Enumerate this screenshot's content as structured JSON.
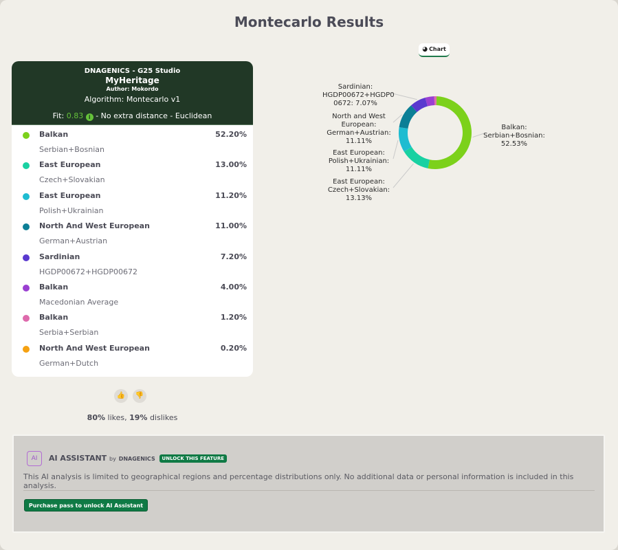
{
  "page": {
    "title": "Montecarlo Results"
  },
  "card": {
    "studio": "DNAGENICS - G25 Studio",
    "name": "MyHeritage",
    "author": "Author: Mokordo",
    "algorithm": "Algorithm: Montecarlo v1",
    "fit_label": "Fit:",
    "fit_value": "0.83",
    "fit_suffix": "- No extra distance - Euclidean",
    "info_icon": "i"
  },
  "populations": [
    {
      "region": "Balkan",
      "sample": "Serbian+Bosnian",
      "pct": "52.20%",
      "color": "#7cd11b"
    },
    {
      "region": "East European",
      "sample": "Czech+Slovakian",
      "pct": "13.00%",
      "color": "#19d1a2"
    },
    {
      "region": "East European",
      "sample": "Polish+Ukrainian",
      "pct": "11.20%",
      "color": "#1ebcd1"
    },
    {
      "region": "North And West European",
      "sample": "German+Austrian",
      "pct": "11.00%",
      "color": "#0c7f96"
    },
    {
      "region": "Sardinian",
      "sample": "HGDP00672+HGDP00672",
      "pct": "7.20%",
      "color": "#5a39cf"
    },
    {
      "region": "Balkan",
      "sample": "Macedonian Average",
      "pct": "4.00%",
      "color": "#9a3fd1"
    },
    {
      "region": "Balkan",
      "sample": "Serbia+Serbian",
      "pct": "1.20%",
      "color": "#de6aac"
    },
    {
      "region": "North And West European",
      "sample": "German+Dutch",
      "pct": "0.20%",
      "color": "#f5a112"
    }
  ],
  "votes": {
    "like_icon": "thumbs-up-icon",
    "dislike_icon": "thumbs-down-icon",
    "likes_pct": "80%",
    "likes_word": "likes,",
    "dislikes_pct": "19%",
    "dislikes_word": "dislikes"
  },
  "chart_tab": {
    "label": "Chart",
    "icon": "pie-chart-icon"
  },
  "chart_data": {
    "type": "pie",
    "style": "donut",
    "legend": "none",
    "slices": [
      {
        "label": "Balkan:\nSerbian+Bosnian:\n52.53%",
        "value": 52.53,
        "color": "#7cd11b"
      },
      {
        "label": "East European:\nCzech+Slovakian:\n13.13%",
        "value": 13.13,
        "color": "#19d1a2"
      },
      {
        "label": "East European:\nPolish+Ukrainian:\n11.11%",
        "value": 11.11,
        "color": "#1ebcd1"
      },
      {
        "label": "North and West\nEuropean:\nGerman+Austrian:\n11.11%",
        "value": 11.11,
        "color": "#0c7f96"
      },
      {
        "label": "Sardinian:\nHGDP00672+HGDP0\n0672: 7.07%",
        "value": 7.07,
        "color": "#5a39cf"
      },
      {
        "label": "",
        "value": 4.04,
        "color": "#9a3fd1"
      },
      {
        "label": "",
        "value": 1.01,
        "color": "#de6aac"
      }
    ]
  },
  "ai": {
    "logo_text": "AI",
    "title": "AI ASSISTANT",
    "by": "by",
    "brand": "DNAGENICS",
    "unlock_badge": "UNLOCK THIS FEATURE",
    "description": "This AI analysis is limited to geographical regions and percentage distributions only. No additional data or personal information is included in this analysis.",
    "purchase_button": "Purchase pass to unlock AI Assistant"
  }
}
